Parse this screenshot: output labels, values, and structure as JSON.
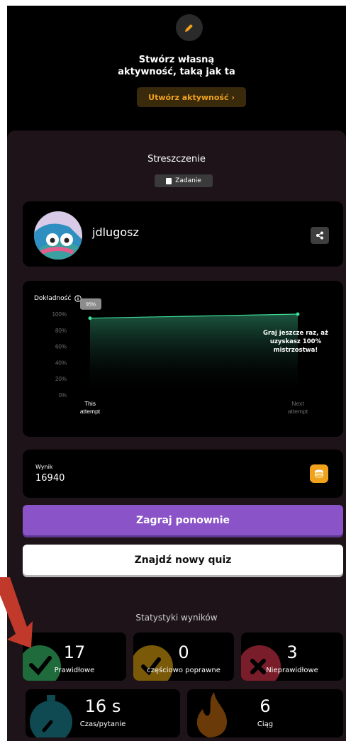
{
  "promo": {
    "title_line1": "Stwórz własną",
    "title_line2": "aktywność, taką jak ta",
    "button_label": "Utwórz aktywność ›"
  },
  "summary": {
    "title": "Streszczenie",
    "task_badge": "Zadanie"
  },
  "user": {
    "username": "jdlugosz"
  },
  "accuracy": {
    "label": "Dokładność",
    "current_badge": "95%",
    "message": [
      "Graj jeszcze raz, aż",
      "uzyskasz 100%",
      "mistrzostwa!"
    ]
  },
  "chart_data": {
    "type": "line",
    "categories": [
      "This attempt",
      "Next attempt"
    ],
    "x_labels": [
      [
        "This",
        "attempt"
      ],
      [
        "Next",
        "attempt"
      ]
    ],
    "values": [
      95,
      100
    ],
    "yticks": [
      "100%",
      "80%",
      "60%",
      "40%",
      "20%",
      "0%"
    ],
    "ylim": [
      0,
      100
    ],
    "title": "Dokładność",
    "grid": false
  },
  "score": {
    "label": "Wynik",
    "value": "16940"
  },
  "buttons": {
    "replay": "Zagraj ponownie",
    "new_quiz": "Znajdź nowy quiz"
  },
  "stats": {
    "title": "Statystyki wyników",
    "correct": {
      "value": "17",
      "label": "Prawidłowe",
      "color": "#1f6b3c"
    },
    "partial": {
      "value": "0",
      "label": "częściowo poprawne",
      "color": "#7a5a08"
    },
    "incorrect": {
      "value": "3",
      "label": "Nieprawidłowe",
      "color": "#7a1d2a"
    },
    "time": {
      "value": "16 s",
      "label": "Czas/pytanie",
      "color": "#0f4a52"
    },
    "streak": {
      "value": "6",
      "label": "Ciąg",
      "color": "#6a3a08"
    }
  },
  "colors": {
    "accent": "#8a54c8",
    "gold": "#f0a21d",
    "chart": "#3ddc97",
    "arrow": "#c0392b"
  }
}
